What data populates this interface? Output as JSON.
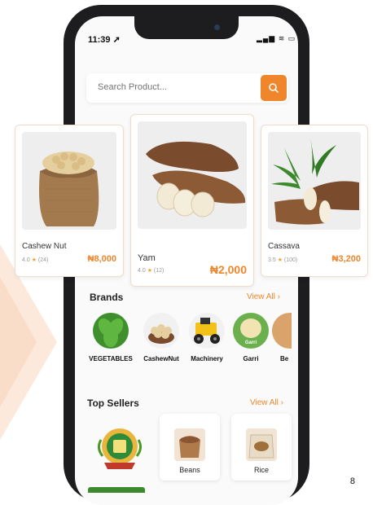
{
  "status_bar": {
    "time": "11:39",
    "icons": "▂▄▆ ≋ ▭"
  },
  "search": {
    "placeholder": "Search Product...",
    "icon": "search-icon"
  },
  "featured": [
    {
      "name": "Cashew Nut",
      "rating": "4.0",
      "reviews": "(24)",
      "price": "₦8,000"
    },
    {
      "name": "Yam",
      "rating": "4.0",
      "reviews": "(12)",
      "price": "₦2,000"
    },
    {
      "name": "Cassava",
      "rating": "3.5",
      "reviews": "(100)",
      "price": "₦3,200"
    }
  ],
  "brands": {
    "title": "Brands",
    "view_all": "View All ›",
    "items": [
      {
        "label": "VEGETABLES"
      },
      {
        "label": "CashewNut"
      },
      {
        "label": "Machinery"
      },
      {
        "label": "Garri",
        "badge": "Garri"
      },
      {
        "label": "Be"
      }
    ]
  },
  "top_sellers": {
    "title": "Top Sellers",
    "view_all": "View All ›",
    "items": [
      {
        "label": ""
      },
      {
        "label": "Beans"
      },
      {
        "label": "Rice"
      }
    ]
  },
  "page_number": "8",
  "colors": {
    "accent": "#f0862c",
    "star": "#e9a23b"
  }
}
